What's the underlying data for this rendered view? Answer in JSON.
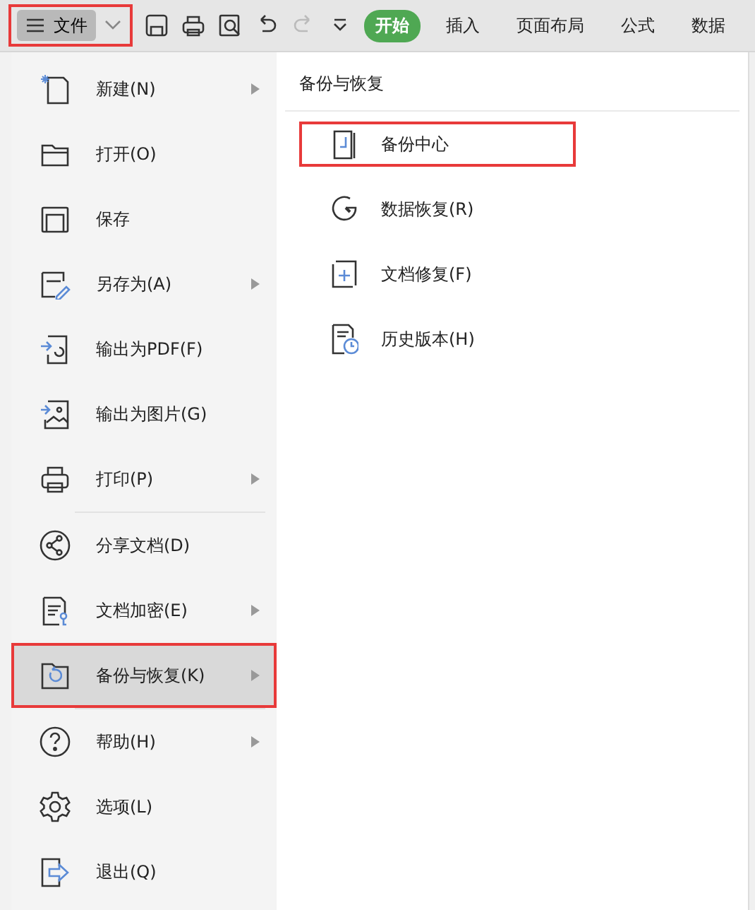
{
  "toolbar": {
    "file_button": {
      "label": "文件",
      "highlighted": true
    },
    "redo_disabled": true,
    "tabs": [
      {
        "label": "开始",
        "selected": true
      },
      {
        "label": "插入",
        "selected": false
      },
      {
        "label": "页面布局",
        "selected": false
      },
      {
        "label": "公式",
        "selected": false
      },
      {
        "label": "数据",
        "selected": false
      }
    ]
  },
  "file_menu": {
    "items": [
      {
        "label": "新建(N)",
        "submenu": true,
        "selected": false,
        "highlighted": false
      },
      {
        "label": "打开(O)",
        "submenu": false,
        "selected": false,
        "highlighted": false
      },
      {
        "label": "保存",
        "submenu": false,
        "selected": false,
        "highlighted": false
      },
      {
        "label": "另存为(A)",
        "submenu": true,
        "selected": false,
        "highlighted": false
      },
      {
        "label": "输出为PDF(F)",
        "submenu": false,
        "selected": false,
        "highlighted": false
      },
      {
        "label": "输出为图片(G)",
        "submenu": false,
        "selected": false,
        "highlighted": false
      },
      {
        "label": "打印(P)",
        "submenu": true,
        "selected": false,
        "highlighted": false,
        "separator_after": true
      },
      {
        "label": "分享文档(D)",
        "submenu": false,
        "selected": false,
        "highlighted": false
      },
      {
        "label": "文档加密(E)",
        "submenu": true,
        "selected": false,
        "highlighted": false
      },
      {
        "label": "备份与恢复(K)",
        "submenu": true,
        "selected": true,
        "highlighted": true,
        "separator_after": true
      },
      {
        "label": "帮助(H)",
        "submenu": true,
        "selected": false,
        "highlighted": false
      },
      {
        "label": "选项(L)",
        "submenu": false,
        "selected": false,
        "highlighted": false
      },
      {
        "label": "退出(Q)",
        "submenu": false,
        "selected": false,
        "highlighted": false
      }
    ]
  },
  "submenu": {
    "title": "备份与恢复",
    "items": [
      {
        "label": "备份中心",
        "highlighted": true
      },
      {
        "label": "数据恢复(R)",
        "highlighted": false
      },
      {
        "label": "文档修复(F)",
        "highlighted": false
      },
      {
        "label": "历史版本(H)",
        "highlighted": false
      }
    ]
  }
}
